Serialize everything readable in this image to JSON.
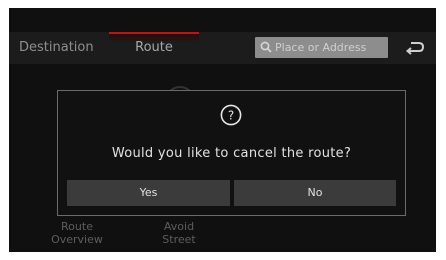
{
  "header": {
    "tabs": [
      {
        "label": "Destination",
        "active": false
      },
      {
        "label": "Route",
        "active": true
      }
    ],
    "search": {
      "placeholder": "Place or Address",
      "icon": "search-icon"
    },
    "back_icon": "back-arrow-icon"
  },
  "menu": {
    "items": [
      {
        "line1": "Route",
        "line2": "Overview"
      },
      {
        "line1": "Avoid",
        "line2": "Street"
      }
    ]
  },
  "dialog": {
    "icon": "question-icon",
    "icon_text": "?",
    "message": "Would you like to cancel the route?",
    "buttons": {
      "yes": "Yes",
      "no": "No"
    }
  },
  "colors": {
    "background": "#101010",
    "active_tab_accent": "#b11a1a",
    "button": "#3b3b3b",
    "dialog_border": "#6b6b6b"
  }
}
